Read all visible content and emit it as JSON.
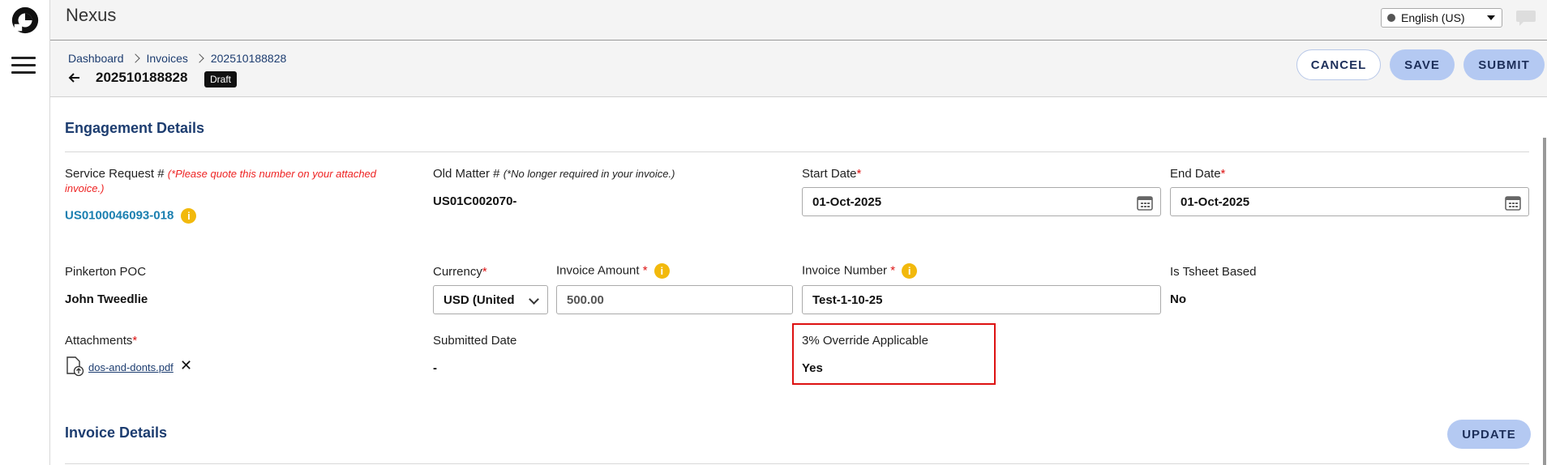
{
  "app": {
    "title": "Nexus"
  },
  "language": {
    "selected": "English (US)"
  },
  "breadcrumb": {
    "items": [
      "Dashboard",
      "Invoices",
      "202510188828"
    ]
  },
  "header": {
    "invoice_id": "202510188828",
    "status_badge": "Draft"
  },
  "actions": {
    "cancel": "CANCEL",
    "save": "SAVE",
    "submit": "SUBMIT"
  },
  "engagement": {
    "title": "Engagement Details",
    "service_request_label": "Service Request #",
    "service_request_note": "(*Please quote this number on your attached invoice.)",
    "service_request_value": "US0100046093-018",
    "old_matter_label": "Old Matter #",
    "old_matter_note": "(*No longer required in your invoice.)",
    "old_matter_value": "US01C002070-",
    "start_date_label": "Start Date",
    "start_date_value": "01-Oct-2025",
    "end_date_label": "End Date",
    "end_date_value": "01-Oct-2025",
    "poc_label": "Pinkerton POC",
    "poc_value": "John Tweedlie",
    "currency_label": "Currency",
    "currency_value": "USD (United",
    "invoice_amount_label": "Invoice Amount",
    "invoice_amount_value": "500.00",
    "invoice_number_label": "Invoice Number",
    "invoice_number_value": "Test-1-10-25",
    "tsheet_label": "Is Tsheet Based",
    "tsheet_value": "No",
    "attachments_label": "Attachments",
    "attachment_file": "dos-and-donts.pdf",
    "submitted_date_label": "Submitted Date",
    "submitted_date_value": "-",
    "override_label": "3% Override Applicable",
    "override_value": "Yes",
    "required_mark": "*",
    "info_glyph": "i",
    "remove_glyph": "✕"
  },
  "invoice_details": {
    "title": "Invoice Details",
    "update_button": "UPDATE"
  },
  "colors": {
    "accent": "#1d3d70",
    "button_fill": "#b4c9f2",
    "info": "#f2b90c",
    "highlight": "#dd1111"
  }
}
